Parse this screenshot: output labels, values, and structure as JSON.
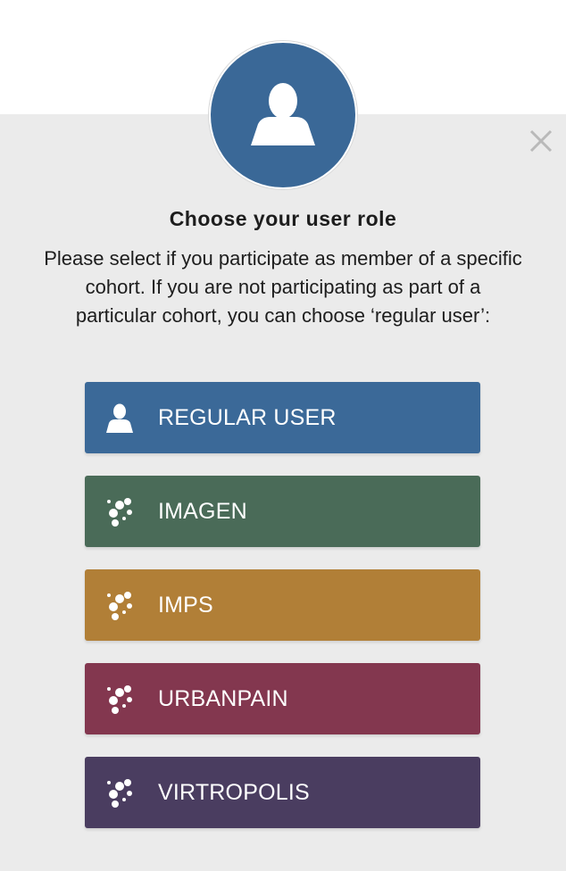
{
  "dialog": {
    "title": "Choose your user role",
    "description": "Please select if you participate as member of a specific cohort. If you are not participating as part of a particular cohort, you can choose ‘regular user’:",
    "close_icon": "close-icon",
    "avatar_icon": "user-icon"
  },
  "roles": [
    {
      "label": "REGULAR USER",
      "icon": "user-icon",
      "color": "#3b6998"
    },
    {
      "label": "IMAGEN",
      "icon": "molecule-icon",
      "color": "#4a6b58"
    },
    {
      "label": "IMPS",
      "icon": "molecule-icon",
      "color": "#b17f37"
    },
    {
      "label": "URBANPAIN",
      "icon": "molecule-icon",
      "color": "#83374f"
    },
    {
      "label": "VIRTROPOLIS",
      "icon": "molecule-icon",
      "color": "#4a3d60"
    }
  ],
  "colors": {
    "panel_bg": "#ebebeb",
    "avatar_bg": "#3a6897"
  }
}
